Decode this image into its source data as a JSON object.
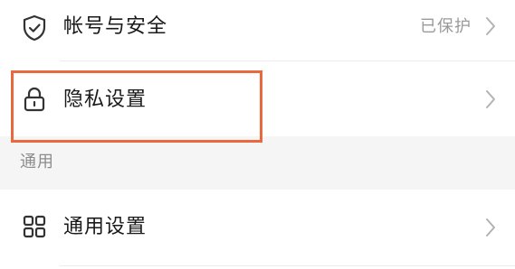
{
  "settings": {
    "account_security": {
      "icon": "shield-check-icon",
      "label": "帐号与安全",
      "status": "已保护"
    },
    "privacy": {
      "icon": "lock-icon",
      "label": "隐私设置"
    },
    "section_general": {
      "title": "通用"
    },
    "general": {
      "icon": "grid-icon",
      "label": "通用设置"
    }
  },
  "colors": {
    "highlight": "#e8693e",
    "section_background": "#f5f5f5",
    "label_text": "#1a1a1a",
    "secondary_text": "#9a9a9a"
  }
}
